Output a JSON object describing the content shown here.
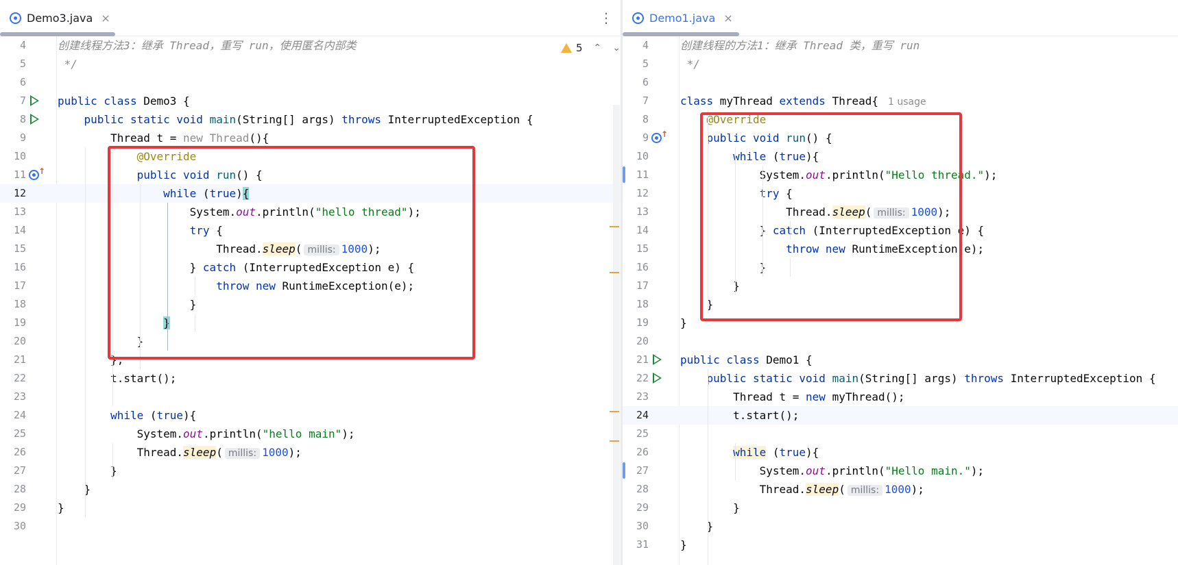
{
  "left": {
    "tab": {
      "label": "Demo3.java",
      "close": "×",
      "more": "⋮"
    },
    "inspection": {
      "warnings": "5",
      "up": "⌃",
      "down": "⌄"
    },
    "lines": [
      {
        "n": "4",
        "html": "<span class=\"cmt\">创建线程方法3：继承 Thread，重写 run，使用匿名内部类</span>"
      },
      {
        "n": "5",
        "html": "<span class=\"cmt\"> */</span>"
      },
      {
        "n": "6",
        "html": ""
      },
      {
        "n": "7",
        "html": "<span class=\"kw\">public class</span> Demo3 {",
        "icon": "run"
      },
      {
        "n": "8",
        "html": "    <span class=\"kw\">public static void</span> <span class=\"fn\">main</span>(String[] args) <span class=\"kw\">throws</span> InterruptedException {",
        "icon": "run"
      },
      {
        "n": "9",
        "html": "        Thread t = <span class=\"gray\">new Thread</span>(){"
      },
      {
        "n": "10",
        "html": "            <span class=\"ann\">@Override</span>"
      },
      {
        "n": "11",
        "html": "            <span class=\"kw\">public void</span> <span class=\"fn\">run</span>() {",
        "icon": "override"
      },
      {
        "n": "12",
        "html": "                <span class=\"kw\">while</span> (<span class=\"kw\">true</span>)<span class=\"brace-hl\">{</span>",
        "current": true
      },
      {
        "n": "13",
        "html": "                    System.<span class=\"static\">out</span>.println(<span class=\"str\">\"hello thread\"</span>);"
      },
      {
        "n": "14",
        "html": "                    <span class=\"kw\">try</span> {"
      },
      {
        "n": "15",
        "html": "                        Thread.<span class=\"static-call\">sleep</span>(<span class=\"hint\">millis:</span><span class=\"num\">1000</span>);"
      },
      {
        "n": "16",
        "html": "                    } <span class=\"kw\">catch</span> (InterruptedException e) {"
      },
      {
        "n": "17",
        "html": "                        <span class=\"kw\">throw new</span> RuntimeException(e);"
      },
      {
        "n": "18",
        "html": "                    }"
      },
      {
        "n": "19",
        "html": "                <span class=\"brace-hl\">}</span>"
      },
      {
        "n": "20",
        "html": "            }"
      },
      {
        "n": "21",
        "html": "        };"
      },
      {
        "n": "22",
        "html": "        t.start();"
      },
      {
        "n": "23",
        "html": ""
      },
      {
        "n": "24",
        "html": "        <span class=\"kw\">while</span> (<span class=\"kw\">true</span>){"
      },
      {
        "n": "25",
        "html": "            System.<span class=\"static\">out</span>.println(<span class=\"str\">\"hello main\"</span>);"
      },
      {
        "n": "26",
        "html": "            Thread.<span class=\"static-call\">sleep</span>(<span class=\"hint\">millis:</span><span class=\"num\">1000</span>);"
      },
      {
        "n": "27",
        "html": "        }"
      },
      {
        "n": "28",
        "html": "    }"
      },
      {
        "n": "29",
        "html": "}"
      },
      {
        "n": "30",
        "html": ""
      }
    ]
  },
  "right": {
    "tab": {
      "label": "Demo1.java",
      "close": "×"
    },
    "lines": [
      {
        "n": "4",
        "html": "<span class=\"cmt\">创建线程的方法1：继承 Thread 类，重写 run</span>"
      },
      {
        "n": "5",
        "html": "<span class=\"cmt\"> */</span>"
      },
      {
        "n": "6",
        "html": ""
      },
      {
        "n": "7",
        "html": "<span class=\"kw\">class</span> myThread <span class=\"kw\">extends</span> Thread{<span class=\"usage\">1 usage</span>"
      },
      {
        "n": "8",
        "html": "    <span class=\"ann\">@Override</span>"
      },
      {
        "n": "9",
        "html": "    <span class=\"kw\">public void</span> <span class=\"fn\">run</span>() {",
        "icon": "override"
      },
      {
        "n": "10",
        "html": "        <span class=\"kw\">while</span> (<span class=\"kw\">true</span>){"
      },
      {
        "n": "11",
        "html": "            System.<span class=\"static\">out</span>.println(<span class=\"str\">\"Hello thread.\"</span>);",
        "change": true
      },
      {
        "n": "12",
        "html": "            <span class=\"kw\">try</span> {"
      },
      {
        "n": "13",
        "html": "                Thread.<span class=\"static-call\">sleep</span>(<span class=\"hint\">millis:</span><span class=\"num\">1000</span>);"
      },
      {
        "n": "14",
        "html": "            } <span class=\"kw\">catch</span> (InterruptedException e) {"
      },
      {
        "n": "15",
        "html": "                <span class=\"kw\">throw new</span> RuntimeException(e);"
      },
      {
        "n": "16",
        "html": "            }"
      },
      {
        "n": "17",
        "html": "        }"
      },
      {
        "n": "18",
        "html": "    }"
      },
      {
        "n": "19",
        "html": "}"
      },
      {
        "n": "20",
        "html": ""
      },
      {
        "n": "21",
        "html": "<span class=\"kw\">public class</span> Demo1 {",
        "icon": "run"
      },
      {
        "n": "22",
        "html": "    <span class=\"kw\">public static void</span> <span class=\"fn\">main</span>(String[] args) <span class=\"kw\">throws</span> InterruptedException {",
        "icon": "run"
      },
      {
        "n": "23",
        "html": "        Thread t = <span class=\"kw\">new</span> myThread();"
      },
      {
        "n": "24",
        "html": "        t.start();",
        "current": true
      },
      {
        "n": "25",
        "html": ""
      },
      {
        "n": "26",
        "html": "        <span class=\"kw kwhl\">while</span> (<span class=\"kw\">true</span>){"
      },
      {
        "n": "27",
        "html": "            System.<span class=\"static\">out</span>.println(<span class=\"str\">\"Hello main.\"</span>);",
        "change": true
      },
      {
        "n": "28",
        "html": "            Thread.<span class=\"static-call\">sleep</span>(<span class=\"hint\">millis:</span><span class=\"num\">1000</span>);"
      },
      {
        "n": "29",
        "html": "        }"
      },
      {
        "n": "30",
        "html": "    }"
      },
      {
        "n": "31",
        "html": "}"
      }
    ]
  }
}
